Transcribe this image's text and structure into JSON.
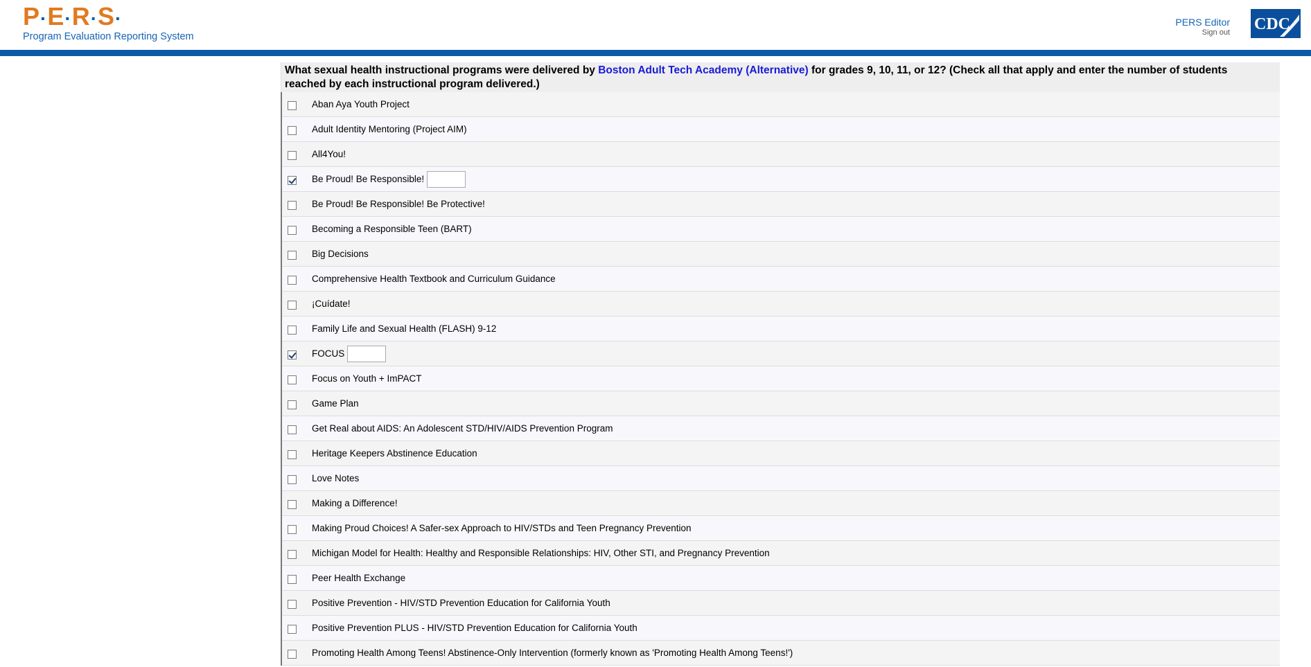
{
  "header": {
    "logo_letters": [
      "P",
      "E",
      "R",
      "S"
    ],
    "logo_subtitle": "Program Evaluation Reporting System",
    "user_role": "PERS Editor",
    "signout_label": "Sign out",
    "cdc_logo_text": "CDC"
  },
  "question": {
    "prefix": "What sexual health instructional programs were delivered by",
    "school": "Boston Adult Tech Academy (Alternative)",
    "suffix": "for grades 9, 10, 11, or 12? (Check all that apply and enter the number of students reached by each instructional program delivered.)"
  },
  "options": [
    {
      "label": "Aban Aya Youth Project",
      "checked": false
    },
    {
      "label": "Adult Identity Mentoring (Project AIM)",
      "checked": false
    },
    {
      "label": "All4You!",
      "checked": false
    },
    {
      "label": "Be Proud! Be Responsible!",
      "checked": true,
      "count": ""
    },
    {
      "label": "Be Proud! Be Responsible! Be Protective!",
      "checked": false
    },
    {
      "label": "Becoming a Responsible Teen (BART)",
      "checked": false
    },
    {
      "label": "Big Decisions",
      "checked": false
    },
    {
      "label": "Comprehensive Health Textbook and Curriculum Guidance",
      "checked": false
    },
    {
      "label": "¡Cuídate!",
      "checked": false
    },
    {
      "label": "Family Life and Sexual Health (FLASH) 9-12",
      "checked": false
    },
    {
      "label": "FOCUS",
      "checked": true,
      "count": ""
    },
    {
      "label": "Focus on Youth + ImPACT",
      "checked": false
    },
    {
      "label": "Game Plan",
      "checked": false
    },
    {
      "label": "Get Real about AIDS: An Adolescent STD/HIV/AIDS Prevention Program",
      "checked": false
    },
    {
      "label": "Heritage Keepers Abstinence Education",
      "checked": false
    },
    {
      "label": "Love Notes",
      "checked": false
    },
    {
      "label": "Making a Difference!",
      "checked": false
    },
    {
      "label": "Making Proud Choices! A Safer-sex Approach to HIV/STDs and Teen Pregnancy Prevention",
      "checked": false
    },
    {
      "label": "Michigan Model for Health: Healthy and Responsible Relationships: HIV, Other STI, and Pregnancy Prevention",
      "checked": false
    },
    {
      "label": "Peer Health Exchange",
      "checked": false
    },
    {
      "label": "Positive Prevention - HIV/STD Prevention Education for California Youth",
      "checked": false
    },
    {
      "label": "Positive Prevention PLUS - HIV/STD Prevention Education for California Youth",
      "checked": false
    },
    {
      "label": "Promoting Health Among Teens! Abstinence-Only Intervention (formerly known as 'Promoting Health Among Teens!')",
      "checked": false
    }
  ]
}
